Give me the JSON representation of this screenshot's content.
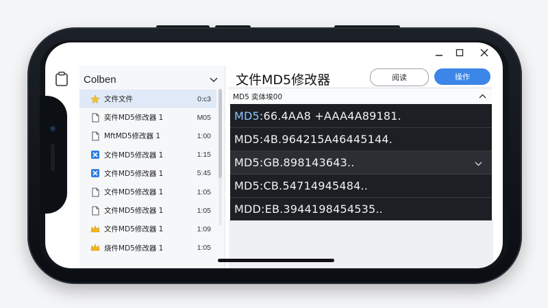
{
  "window": {
    "minimize_icon": "minimize-icon",
    "maximize_icon": "maximize-icon",
    "close_icon": "close-icon"
  },
  "sidebar": {
    "title": "Colben",
    "items": [
      {
        "name": "文件文件",
        "meta": "0:c3",
        "icon": "star-folder-icon",
        "selected": true
      },
      {
        "name": "奕件MD5修改器 1",
        "meta": "M05",
        "icon": "file-icon",
        "selected": false
      },
      {
        "name": "MftMD5修改器 1",
        "meta": "1:00",
        "icon": "file-icon",
        "selected": false
      },
      {
        "name": "文件MD5修改器 1",
        "meta": "1:15",
        "icon": "checkbox-icon",
        "selected": false
      },
      {
        "name": "文件MD5修改器 1",
        "meta": "5:45",
        "icon": "checkbox-icon",
        "selected": false
      },
      {
        "name": "文件MD5修改器 1",
        "meta": "1:05",
        "icon": "file-icon",
        "selected": false
      },
      {
        "name": "文件MD5修改器 1",
        "meta": "1:05",
        "icon": "file-icon",
        "selected": false
      },
      {
        "name": "文件MD5修改器 1",
        "meta": "1:09",
        "icon": "crown-icon",
        "selected": false
      },
      {
        "name": "烧件MD5修改器 1",
        "meta": "1:05",
        "icon": "crown-icon",
        "selected": false
      }
    ]
  },
  "main": {
    "title": "文件MD5修改器",
    "secondary_button": "阅读",
    "primary_button": "操作",
    "section_label": "MD5 奕体埃00",
    "hashes": [
      {
        "prefix": "MD5",
        "value": ":66.4AA8 +AAA4A89181."
      },
      {
        "prefix": "MD5",
        "value": ":4B.964215A46445144."
      },
      {
        "prefix": "MD5",
        "value": ":GB.898143643.."
      },
      {
        "prefix": "MD5",
        "value": ":CB.54714945484.."
      },
      {
        "prefix": "MDD",
        "value": ":EB.3944198454535.."
      }
    ]
  },
  "colors": {
    "accent": "#3b86e6",
    "selected_row": "#dfe9f7",
    "hash_panel_bg": "#1c1f23",
    "hash_highlight": "#8fc4ff"
  }
}
